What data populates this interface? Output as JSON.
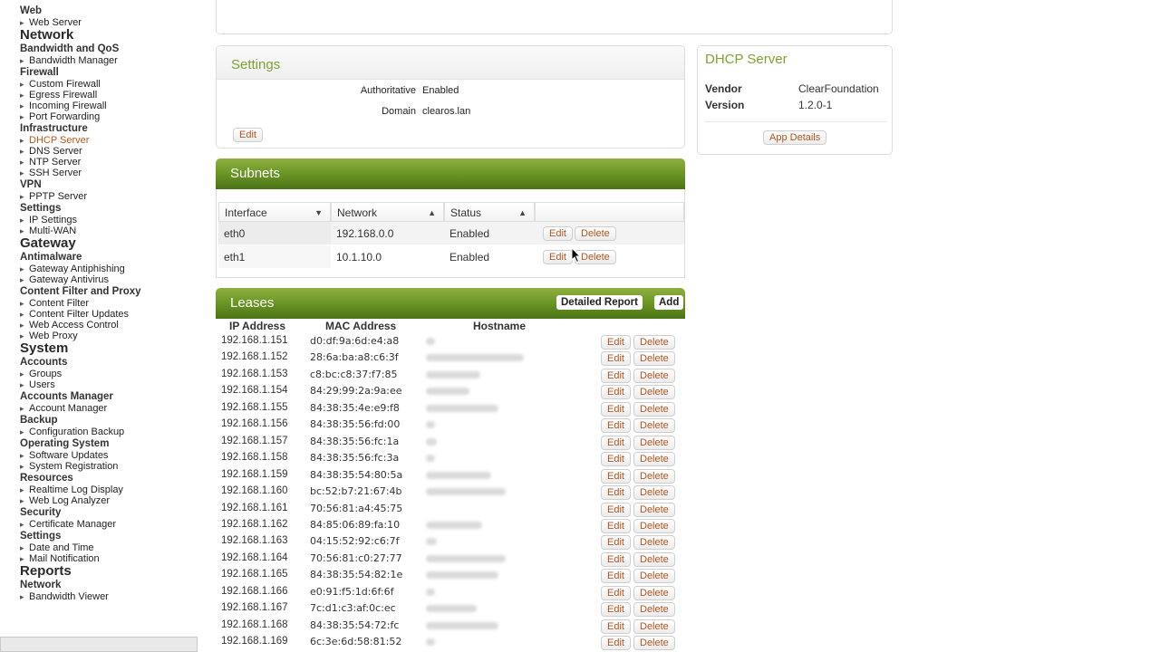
{
  "sidebar": {
    "sections": [
      {
        "category": "",
        "groups": [
          {
            "name": "Web",
            "items": [
              "Web Server"
            ]
          }
        ]
      },
      {
        "category": "Network",
        "groups": [
          {
            "name": "Bandwidth and QoS",
            "items": [
              "Bandwidth Manager"
            ]
          },
          {
            "name": "Firewall",
            "items": [
              "Custom Firewall",
              "Egress Firewall",
              "Incoming Firewall",
              "Port Forwarding"
            ]
          },
          {
            "name": "Infrastructure",
            "items": [
              "DHCP Server",
              "DNS Server",
              "NTP Server",
              "SSH Server"
            ]
          },
          {
            "name": "VPN",
            "items": [
              "PPTP Server"
            ]
          },
          {
            "name": "Settings",
            "items": [
              "IP Settings",
              "Multi-WAN"
            ]
          }
        ]
      },
      {
        "category": "Gateway",
        "groups": [
          {
            "name": "Antimalware",
            "items": [
              "Gateway Antiphishing",
              "Gateway Antivirus"
            ]
          },
          {
            "name": "Content Filter and Proxy",
            "items": [
              "Content Filter",
              "Content Filter Updates",
              "Web Access Control",
              "Web Proxy"
            ]
          }
        ]
      },
      {
        "category": "System",
        "groups": [
          {
            "name": "Accounts",
            "items": [
              "Groups",
              "Users"
            ]
          },
          {
            "name": "Accounts Manager",
            "items": [
              "Account Manager"
            ]
          },
          {
            "name": "Backup",
            "items": [
              "Configuration Backup"
            ]
          },
          {
            "name": "Operating System",
            "items": [
              "Software Updates",
              "System Registration"
            ]
          },
          {
            "name": "Resources",
            "items": [
              "Realtime Log Display",
              "Web Log Analyzer"
            ]
          },
          {
            "name": "Security",
            "items": [
              "Certificate Manager"
            ]
          },
          {
            "name": "Settings",
            "items": [
              "Date and Time",
              "Mail Notification"
            ]
          }
        ]
      },
      {
        "category": "Reports",
        "groups": [
          {
            "name": "Network",
            "items": [
              "Bandwidth Viewer"
            ]
          }
        ]
      }
    ],
    "active_item": "DHCP Server"
  },
  "settings": {
    "title": "Settings",
    "authoritative_label": "Authoritative",
    "authoritative_value": "Enabled",
    "domain_label": "Domain",
    "domain_value": "clearos.lan",
    "edit_label": "Edit"
  },
  "app_info": {
    "title": "DHCP Server",
    "vendor_label": "Vendor",
    "vendor_value": "ClearFoundation",
    "version_label": "Version",
    "version_value": "1.2.0-1",
    "details_label": "App Details"
  },
  "subnets": {
    "title": "Subnets",
    "columns": [
      "Interface",
      "Network",
      "Status"
    ],
    "rows": [
      {
        "interface": "eth0",
        "network": "192.168.0.0",
        "status": "Enabled"
      },
      {
        "interface": "eth1",
        "network": "10.1.10.0",
        "status": "Enabled"
      }
    ],
    "edit_label": "Edit",
    "delete_label": "Delete"
  },
  "leases": {
    "title": "Leases",
    "detailed_report_label": "Detailed Report",
    "add_label": "Add",
    "columns": [
      "IP Address",
      "MAC Address",
      "Hostname"
    ],
    "edit_label": "Edit",
    "delete_label": "Delete",
    "rows": [
      {
        "ip": "192.168.1.151",
        "mac": "d0:df:9a:6d:e4:a8"
      },
      {
        "ip": "192.168.1.152",
        "mac": "28:6a:ba:a8:c6:3f"
      },
      {
        "ip": "192.168.1.153",
        "mac": "c8:bc:c8:37:f7:85"
      },
      {
        "ip": "192.168.1.154",
        "mac": "84:29:99:2a:9a:ee"
      },
      {
        "ip": "192.168.1.155",
        "mac": "84:38:35:4e:e9:f8"
      },
      {
        "ip": "192.168.1.156",
        "mac": "84:38:35:56:fd:00"
      },
      {
        "ip": "192.168.1.157",
        "mac": "84:38:35:56:fc:1a"
      },
      {
        "ip": "192.168.1.158",
        "mac": "84:38:35:56:fc:3a"
      },
      {
        "ip": "192.168.1.159",
        "mac": "84:38:35:54:80:5a"
      },
      {
        "ip": "192.168.1.160",
        "mac": "bc:52:b7:21:67:4b"
      },
      {
        "ip": "192.168.1.161",
        "mac": "70:56:81:a4:45:75"
      },
      {
        "ip": "192.168.1.162",
        "mac": "84:85:06:89:fa:10"
      },
      {
        "ip": "192.168.1.163",
        "mac": "04:15:52:92:c6:7f"
      },
      {
        "ip": "192.168.1.164",
        "mac": "70:56:81:c0:27:77"
      },
      {
        "ip": "192.168.1.165",
        "mac": "84:38:35:54:82:1e"
      },
      {
        "ip": "192.168.1.166",
        "mac": "e0:91:f5:1d:6f:6f"
      },
      {
        "ip": "192.168.1.167",
        "mac": "7c:d1:c3:af:0c:ec"
      },
      {
        "ip": "192.168.1.168",
        "mac": "84:38:35:54:72:fc"
      },
      {
        "ip": "192.168.1.169",
        "mac": "6c:3e:6d:58:81:52"
      }
    ]
  },
  "colors": {
    "accent_green": "#7da233",
    "header_green": "#6d9826",
    "link_orange": "#b5561f"
  }
}
